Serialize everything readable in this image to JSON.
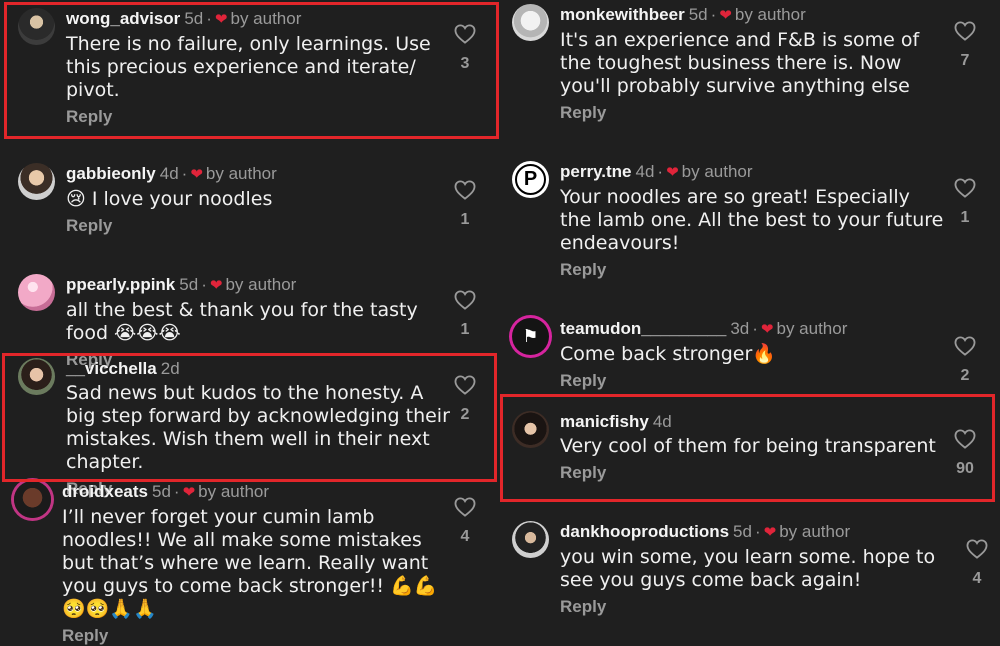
{
  "reply_label": "Reply",
  "by_author": "by author",
  "left": [
    {
      "user": "wong_advisor",
      "time": "5d",
      "author_liked": true,
      "lines": [
        "There is no failure, only learnings. Use",
        "this precious experience and iterate/",
        "pivot."
      ],
      "likes": "3"
    },
    {
      "user": "gabbieonly",
      "time": "4d",
      "author_liked": true,
      "lines": [
        "😢 I love your noodles"
      ],
      "likes": "1"
    },
    {
      "user": "ppearly.ppink",
      "time": "5d",
      "author_liked": true,
      "lines": [
        "all the best & thank you for the tasty",
        "food 😭😭😭"
      ],
      "likes": "1"
    },
    {
      "user": "__vicchella",
      "time": "2d",
      "author_liked": false,
      "lines": [
        "Sad news but kudos to the honesty. A",
        "big step forward by acknowledging their",
        "mistakes. Wish them well in their next",
        "chapter."
      ],
      "likes": "2"
    },
    {
      "user": "droidxeats",
      "time": "5d",
      "author_liked": true,
      "lines": [
        "I’ll never forget your cumin lamb",
        "noodles!! We all make some mistakes",
        "but that’s where we learn. Really want",
        "you guys to come back stronger!! 💪💪",
        "🥺🥺🙏🙏"
      ],
      "likes": "4"
    }
  ],
  "right": [
    {
      "user": "monkewithbeer",
      "time": "5d",
      "author_liked": true,
      "lines": [
        "It's an experience and F&B is some of",
        "the toughest business there is. Now",
        "you'll probably survive anything else"
      ],
      "likes": "7"
    },
    {
      "user": "perry.tne",
      "time": "4d",
      "author_liked": true,
      "lines": [
        "Your noodles are so great! Especially",
        "the lamb one. All the best to your future",
        "endeavours!"
      ],
      "likes": "1"
    },
    {
      "user": "teamudon_________",
      "time": "3d",
      "author_liked": true,
      "lines": [
        "Come back stronger🔥"
      ],
      "likes": "2"
    },
    {
      "user": "manicfishy",
      "time": "4d",
      "author_liked": false,
      "lines": [
        "Very cool of them for being transparent"
      ],
      "likes": "90"
    },
    {
      "user": "dankhooproductions",
      "time": "5d",
      "author_liked": true,
      "lines": [
        "you win some, you learn some. hope to",
        "see you guys come back again!"
      ],
      "likes": "4"
    }
  ],
  "avatar_letter_perry": "P",
  "colors": {
    "background": "#1f1f1f",
    "highlight": "#e2262a",
    "heart": "#e0243a",
    "muted": "#9a9a9a"
  }
}
